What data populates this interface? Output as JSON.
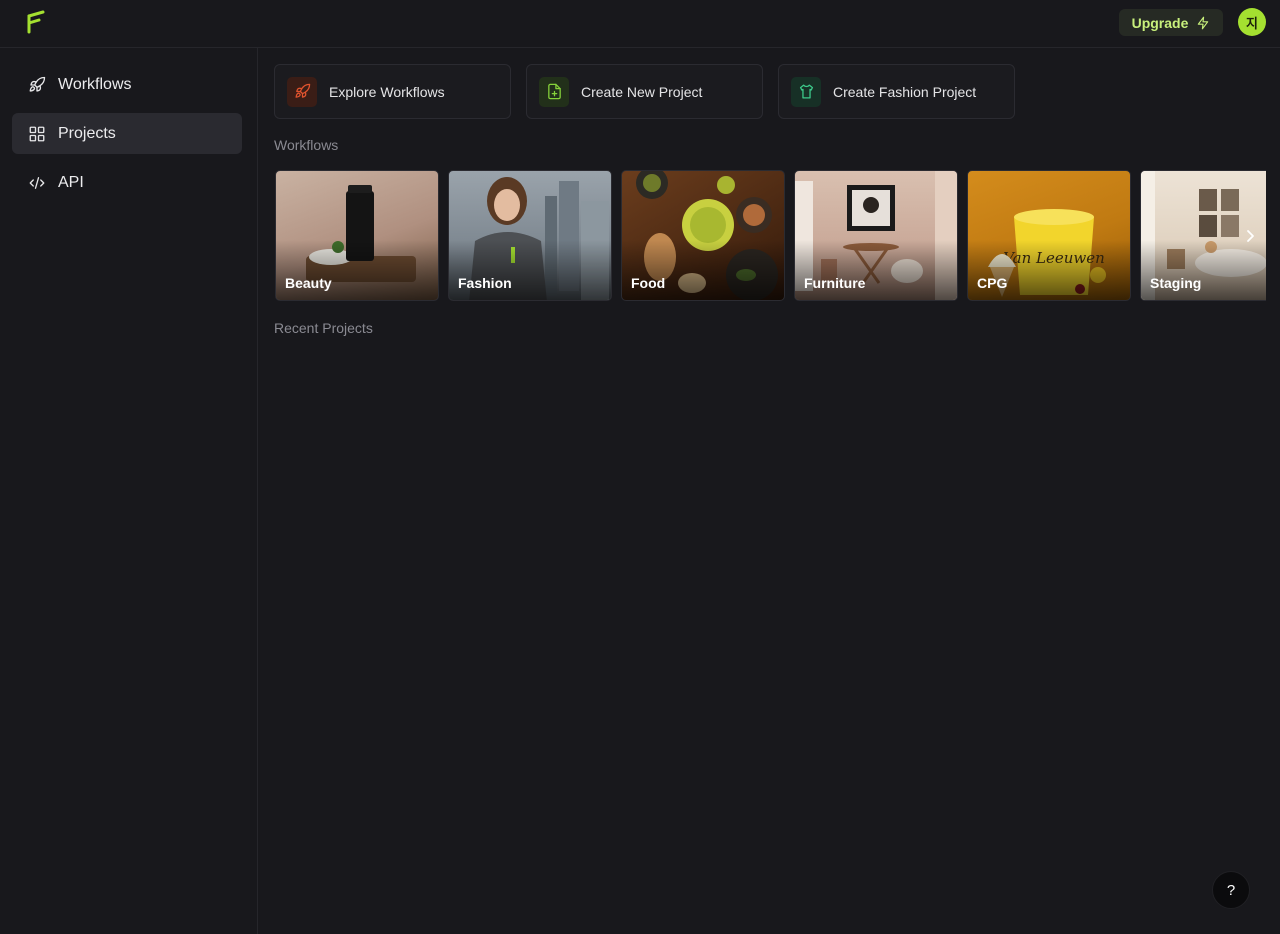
{
  "header": {
    "upgrade_label": "Upgrade",
    "avatar_initial": "지"
  },
  "sidebar": {
    "items": [
      {
        "label": "Workflows",
        "icon": "rocket-icon",
        "active": false
      },
      {
        "label": "Projects",
        "icon": "grid-icon",
        "active": true
      },
      {
        "label": "API",
        "icon": "code-icon",
        "active": false
      }
    ]
  },
  "quick_actions": [
    {
      "label": "Explore Workflows",
      "icon": "rocket-icon",
      "color": "#e0532e"
    },
    {
      "label": "Create New Project",
      "icon": "file-plus-icon",
      "color": "#86d23a"
    },
    {
      "label": "Create Fashion Project",
      "icon": "shirt-icon",
      "color": "#3cc98a"
    }
  ],
  "workflows_section": {
    "title": "Workflows",
    "cards": [
      {
        "label": "Beauty"
      },
      {
        "label": "Fashion"
      },
      {
        "label": "Food"
      },
      {
        "label": "Furniture"
      },
      {
        "label": "CPG"
      },
      {
        "label": "Staging"
      }
    ]
  },
  "recent_section": {
    "title": "Recent Projects"
  },
  "help": {
    "label": "?"
  },
  "colors": {
    "background": "#18181c",
    "accent": "#a4e030",
    "upgrade_text": "#c8f07c"
  }
}
